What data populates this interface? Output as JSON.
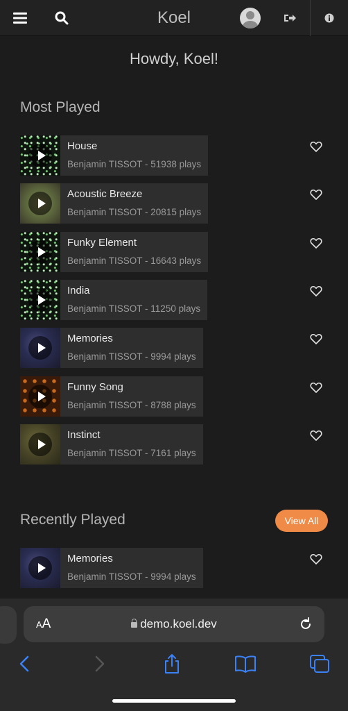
{
  "header": {
    "title": "Koel"
  },
  "greeting": "Howdy, Koel!",
  "most_played": {
    "title": "Most Played",
    "songs": [
      {
        "title": "House",
        "meta": "Benjamin TISSOT - 51938 plays",
        "art": "stars"
      },
      {
        "title": "Acoustic Breeze",
        "meta": "Benjamin TISSOT - 20815 plays",
        "art": "breeze"
      },
      {
        "title": "Funky Element",
        "meta": "Benjamin TISSOT - 16643 plays",
        "art": "stars"
      },
      {
        "title": "India",
        "meta": "Benjamin TISSOT - 11250 plays",
        "art": "stars"
      },
      {
        "title": "Memories",
        "meta": "Benjamin TISSOT - 9994 plays",
        "art": "memories"
      },
      {
        "title": "Funny Song",
        "meta": "Benjamin TISSOT - 8788 plays",
        "art": "funny"
      },
      {
        "title": "Instinct",
        "meta": "Benjamin TISSOT - 7161 plays",
        "art": "instinct"
      }
    ]
  },
  "recently_played": {
    "title": "Recently Played",
    "view_all_label": "View All",
    "songs": [
      {
        "title": "Memories",
        "meta": "Benjamin TISSOT - 9994 plays",
        "art": "memories"
      }
    ]
  },
  "browser": {
    "aa_small": "A",
    "aa_big": "A",
    "url": "demo.koel.dev"
  },
  "colors": {
    "accent": "#f08a47",
    "browser_blue": "#3b82f6"
  },
  "icons": [
    "menu-icon",
    "search-icon",
    "avatar",
    "logout-icon",
    "info-icon",
    "play-icon",
    "heart-icon",
    "lock-icon",
    "reload-icon",
    "back-icon",
    "forward-icon",
    "share-icon",
    "bookmarks-icon",
    "tabs-icon"
  ]
}
